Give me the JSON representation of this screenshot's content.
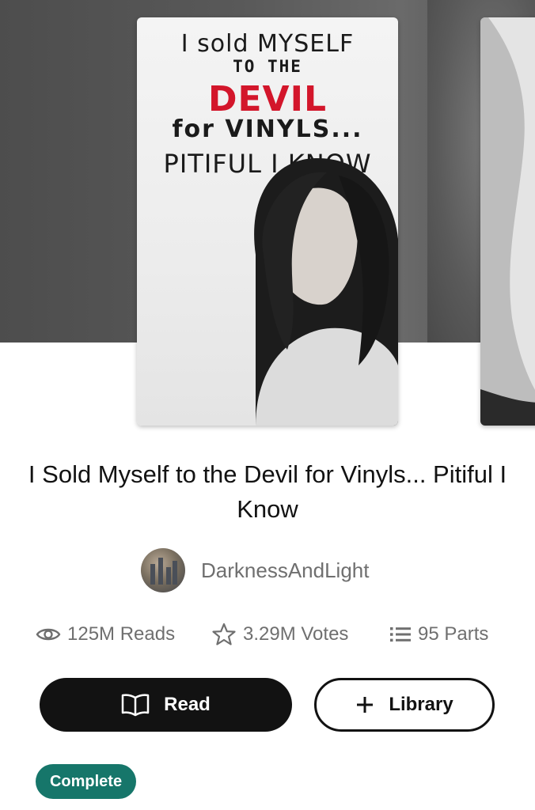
{
  "cover": {
    "line1": "I sold MYSELF",
    "line2": "TO THE",
    "line3": "DEVIL",
    "line4": "for VINYLS...",
    "line5": "PITIFUL I KNOW"
  },
  "story": {
    "title": "I Sold Myself to the Devil for Vinyls... Pitiful I Know",
    "author": "DarknessAndLight"
  },
  "stats": {
    "reads": "125M Reads",
    "votes": "3.29M Votes",
    "parts": "95 Parts"
  },
  "actions": {
    "read_label": "Read",
    "library_label": "Library"
  },
  "status_badge": "Complete",
  "colors": {
    "accent": "#16766a",
    "primary_button": "#121212",
    "cover_red": "#d3162b",
    "muted_text": "#6f6f6f"
  },
  "icons": {
    "reads": "eye-icon",
    "votes": "star-icon",
    "parts": "list-icon",
    "read": "book-icon",
    "library": "plus-icon"
  }
}
